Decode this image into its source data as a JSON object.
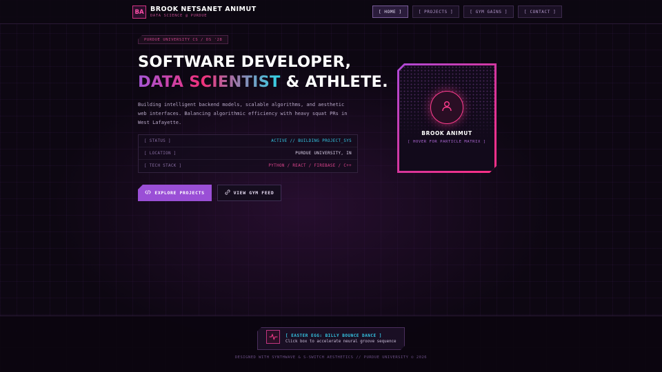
{
  "header": {
    "logo_initials": "BA",
    "brand_name": "BROOK NETSANET ANIMUT",
    "brand_subtitle": "DATA SCIENCE @ PURDUE",
    "nav": [
      {
        "label": "[ HOME ]",
        "active": true
      },
      {
        "label": "[ PROJECTS ]",
        "active": false
      },
      {
        "label": "[ GYM GAINS ]",
        "active": false
      },
      {
        "label": "[ CONTACT ]",
        "active": false
      }
    ]
  },
  "hero": {
    "badge": "PURDUE UNIVERSITY CS / DS '28",
    "headline_line1": "SOFTWARE DEVELOPER,",
    "headline_gradient": "DATA SCIENTIST",
    "headline_rest": " & ATHLETE.",
    "intro": "Building intelligent backend models, scalable algorithms, and aesthetic web interfaces. Balancing algorithmic efficiency with heavy squat PRs in West Lafayette.",
    "info": [
      {
        "key": "[ STATUS ]",
        "value": "ACTIVE // BUILDING PROJECT_SYS",
        "tone": "cyan"
      },
      {
        "key": "[ LOCATION ]",
        "value": "PURDUE UNIVERSITY, IN",
        "tone": "plain"
      },
      {
        "key": "[ TECH STACK ]",
        "value": "PYTHON / REACT / FIREBASE / C++",
        "tone": "pink"
      }
    ],
    "primary_button": "EXPLORE PROJECTS",
    "secondary_button": "VIEW GYM FEED"
  },
  "profile_card": {
    "name": "BROOK ANIMUT",
    "hint": "[ HOVER FOR PARTICLE MATRIX ]"
  },
  "footer": {
    "easter_egg_title": "[ EASTER EGG: BILLY BOUNCE DANCE ]",
    "easter_egg_subtitle": "Click box to accelerate neural groove sequence",
    "credits": "DESIGNED WITH SYNTHWAVE & S-SWITCH AESTHETICS // PURDUE UNIVERSITY © 2026"
  },
  "colors": {
    "background": "#0d0712",
    "accent_purple": "#9a4fd6",
    "accent_pink": "#ff3d8e",
    "accent_cyan": "#34c9e6"
  },
  "icons": {
    "primary_button_icon": "code-icon",
    "secondary_button_icon": "link-icon",
    "avatar_icon": "user-icon",
    "easter_egg_icon": "pulse-icon"
  }
}
